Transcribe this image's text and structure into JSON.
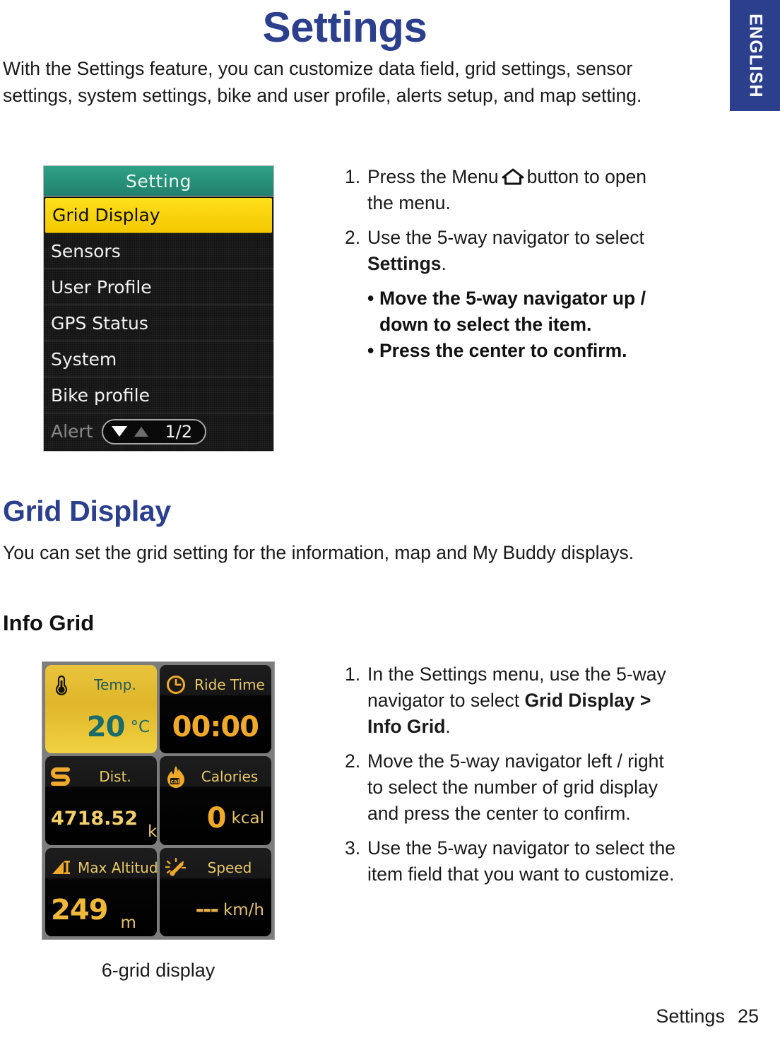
{
  "language_tab": {
    "label": "ENGLISH",
    "color": "#2b3f8c"
  },
  "page_title": "Settings",
  "intro": "With the Settings feature, you can customize data field, grid settings, sensor settings, system settings, bike and user profile, alerts setup, and map setting.",
  "settings_steps": {
    "step1_num": "1.",
    "step1_part_a": "Press the Menu",
    "step1_icon": "home-icon",
    "step1_part_b": "button to open the menu.",
    "step2_num": "2.",
    "step2_part_a": "Use the 5-way navigator to select ",
    "step2_bold": "Settings",
    "step2_part_b": ".",
    "bullet1": "Move the 5-way navigator up / down to select the item.",
    "bullet2": "Press the center to confirm.",
    "bullet_dot": "•"
  },
  "device_menu": {
    "header_title": "Setting",
    "items": [
      {
        "label": "Grid Display",
        "selected": true
      },
      {
        "label": "Sensors",
        "selected": false
      },
      {
        "label": "User Profile",
        "selected": false
      },
      {
        "label": "GPS Status",
        "selected": false
      },
      {
        "label": "System",
        "selected": false
      },
      {
        "label": "Bike profile",
        "selected": false
      }
    ],
    "last_item_label": "Alert",
    "pager_count": "1/2"
  },
  "grid_display_section": {
    "heading": "Grid Display",
    "description": "You can set the grid setting for the information, map and My Buddy displays.",
    "subheading": "Info Grid"
  },
  "info_grid_steps": {
    "step1_num": "1.",
    "step1_part_a": "In the Settings menu, use the 5-way navigator to select ",
    "step1_bold": "Grid Display > Info Grid",
    "step1_part_b": ".",
    "step2_num": "2.",
    "step2_text": "Move the 5-way navigator left / right to select the number of grid display and press the center to confirm.",
    "step3_num": "3.",
    "step3_text": "Use the 5-way navigator to select the item field that you want to customize."
  },
  "grid_shot": {
    "cells": [
      {
        "label": "Temp.",
        "value": "20",
        "unit": "°C",
        "icon": "thermometer-icon",
        "highlight": true
      },
      {
        "label": "Ride Time",
        "value": "00:00",
        "unit": "",
        "icon": "clock-icon",
        "highlight": false
      },
      {
        "label": "Dist.",
        "value": "4718.52",
        "unit": "km",
        "icon": "route-icon",
        "highlight": false
      },
      {
        "label": "Calories",
        "value": "0",
        "unit": "kcal",
        "icon": "flame-icon",
        "highlight": false
      },
      {
        "label": "Max Altitude",
        "value": "249",
        "unit": "m",
        "icon": "mountain-icon",
        "highlight": false
      },
      {
        "label": "Speed",
        "value": "---",
        "unit": "km/h",
        "icon": "speedometer-icon",
        "highlight": false
      }
    ],
    "caption": "6-grid display"
  },
  "footer": {
    "section": "Settings",
    "page_number": "25"
  }
}
